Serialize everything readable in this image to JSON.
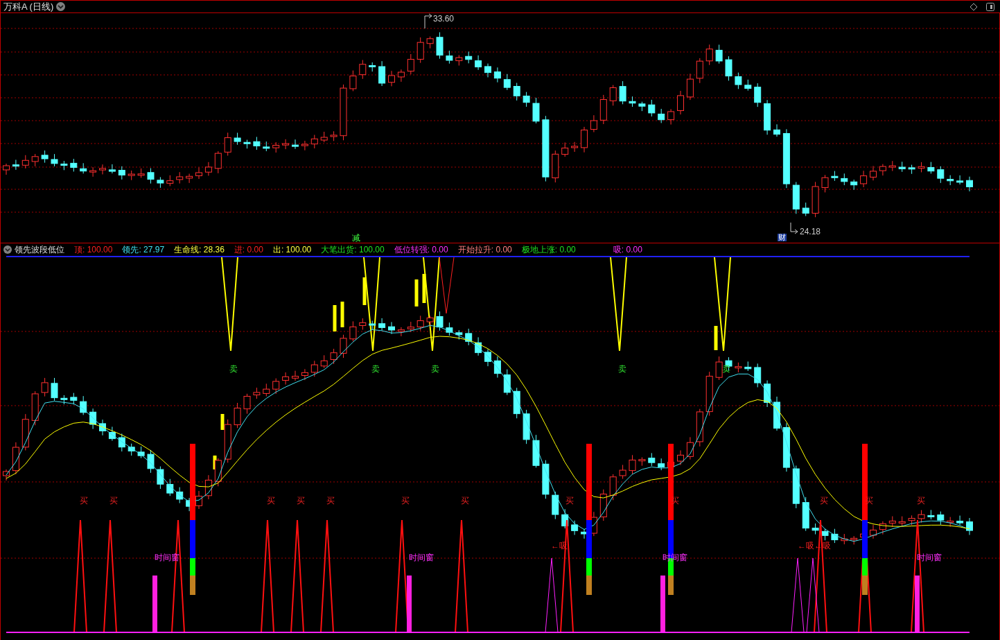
{
  "window": {
    "title": "万科A (日线)"
  },
  "price_chart": {
    "high_label": "33.60",
    "low_label": "24.18",
    "markers": [
      {
        "text": "减",
        "kind": "signal"
      },
      {
        "text": "财",
        "kind": "finance"
      }
    ]
  },
  "indicator": {
    "name": "领先波段低位",
    "values": [
      {
        "label": "顶:",
        "value": "100.00",
        "color": "#ff2020"
      },
      {
        "label": "领先:",
        "value": "27.97",
        "color": "#40e0f0"
      },
      {
        "label": "生命线:",
        "value": "28.36",
        "color": "#ffff40"
      },
      {
        "label": "进:",
        "value": "0.00",
        "color": "#ff2020"
      },
      {
        "label": "出:",
        "value": "100.00",
        "color": "#ffff40"
      },
      {
        "label": "大笔出货:",
        "value": "100.00",
        "color": "#20e020"
      },
      {
        "label": "低位转强:",
        "value": "0.00",
        "color": "#ff30ff"
      },
      {
        "label": "开始拉升:",
        "value": "0.00",
        "color": "#ff8080"
      },
      {
        "label": "极地上涨:",
        "value": "0.00",
        "color": "#20e020"
      },
      {
        "label": "吸:",
        "value": "0.00",
        "color": "#ff30ff"
      }
    ]
  },
  "signals": {
    "sell": [
      "卖",
      "卖",
      "卖",
      "卖",
      "卖"
    ],
    "buy": [
      "买",
      "买",
      "买",
      "买",
      "买",
      "买",
      "买",
      "买",
      "买",
      "买",
      "买",
      "买"
    ],
    "time_window": [
      "时间窗",
      "时间窗",
      "时间窗",
      "时间窗"
    ],
    "absorb": [
      "←吸",
      "←吸←吸"
    ]
  }
}
